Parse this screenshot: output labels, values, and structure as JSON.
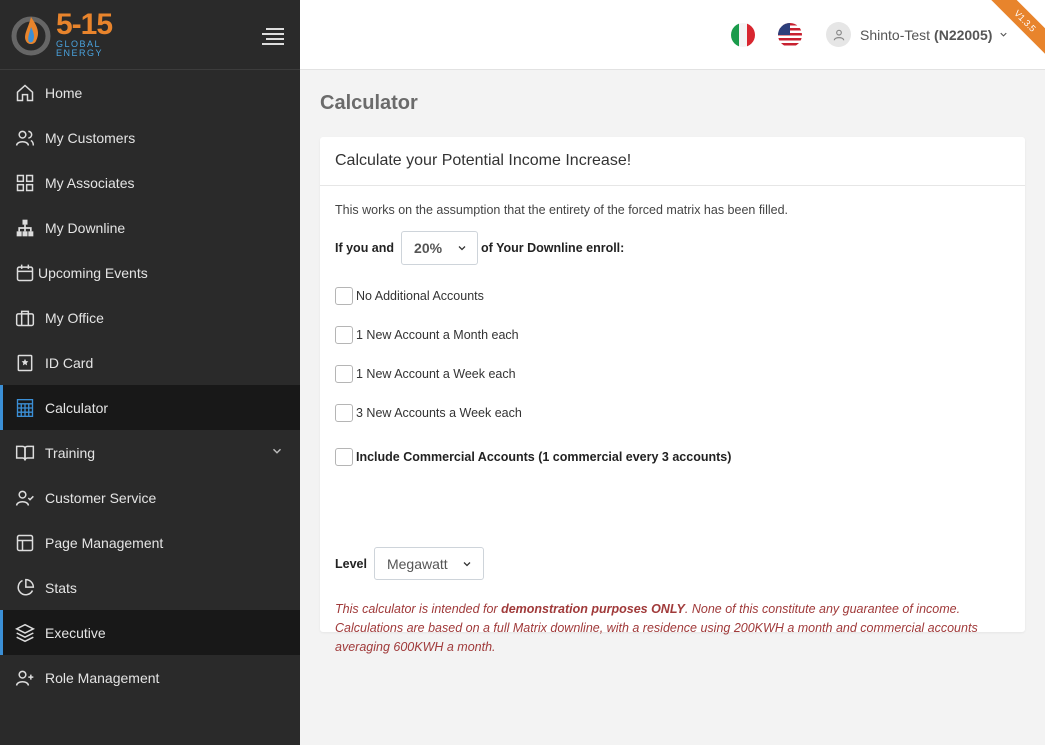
{
  "brand": {
    "logo_big": "5-15",
    "logo_line1": "GLOBAL",
    "logo_line2": "ENERGY"
  },
  "sidebar": {
    "items": [
      {
        "label": "Home",
        "icon": "home-icon"
      },
      {
        "label": "My Customers",
        "icon": "users-icon"
      },
      {
        "label": "My Associates",
        "icon": "grid-icon"
      },
      {
        "label": "My Downline",
        "icon": "hierarchy-icon"
      },
      {
        "label": "Upcoming Events",
        "icon": "calendar-icon"
      },
      {
        "label": "My Office",
        "icon": "briefcase-icon"
      },
      {
        "label": "ID Card",
        "icon": "bookmark-icon"
      },
      {
        "label": "Calculator",
        "icon": "calculator-icon",
        "active": true
      },
      {
        "label": "Training",
        "icon": "book-icon",
        "has_submenu": true
      },
      {
        "label": "Customer Service",
        "icon": "user-check-icon"
      },
      {
        "label": "Page Management",
        "icon": "layout-icon"
      },
      {
        "label": "Stats",
        "icon": "pie-chart-icon"
      },
      {
        "label": "Executive",
        "icon": "layers-icon",
        "active": true
      },
      {
        "label": "Role Management",
        "icon": "user-plus-icon"
      }
    ]
  },
  "topbar": {
    "flags": [
      "italy-flag-icon",
      "usa-flag-icon"
    ],
    "user_name": "Shinto-Test",
    "user_id": "(N22005)",
    "version": "V1.3.5"
  },
  "page": {
    "title": "Calculator"
  },
  "calculator": {
    "header": "Calculate your Potential Income Increase!",
    "intro": "This works on the assumption that the entirety of the forced matrix has been filled.",
    "enroll_prefix": "If you and",
    "enroll_percent": "20%",
    "enroll_suffix": "of Your Downline enroll:",
    "options": [
      "No Additional Accounts",
      "1 New Account a Month each",
      "1 New Account a Week each",
      "3 New Accounts a Week each"
    ],
    "commercial_option": "Include Commercial Accounts (1 commercial every 3 accounts)",
    "level_label": "Level",
    "level_value": "Megawatt",
    "disclaimer_1": "This calculator is intended for ",
    "disclaimer_bold": "demonstration purposes ONLY",
    "disclaimer_2": ". None of this constitute any guarantee of income. Calculations are based on a full Matrix downline, with a residence using 200KWH a month and commercial accounts averaging 600KWH a month."
  },
  "colors": {
    "accent_orange": "#e8842c",
    "accent_blue": "#3b8fd6",
    "sidebar_bg": "#2a2a2a",
    "disclaimer": "#a03a3a"
  }
}
